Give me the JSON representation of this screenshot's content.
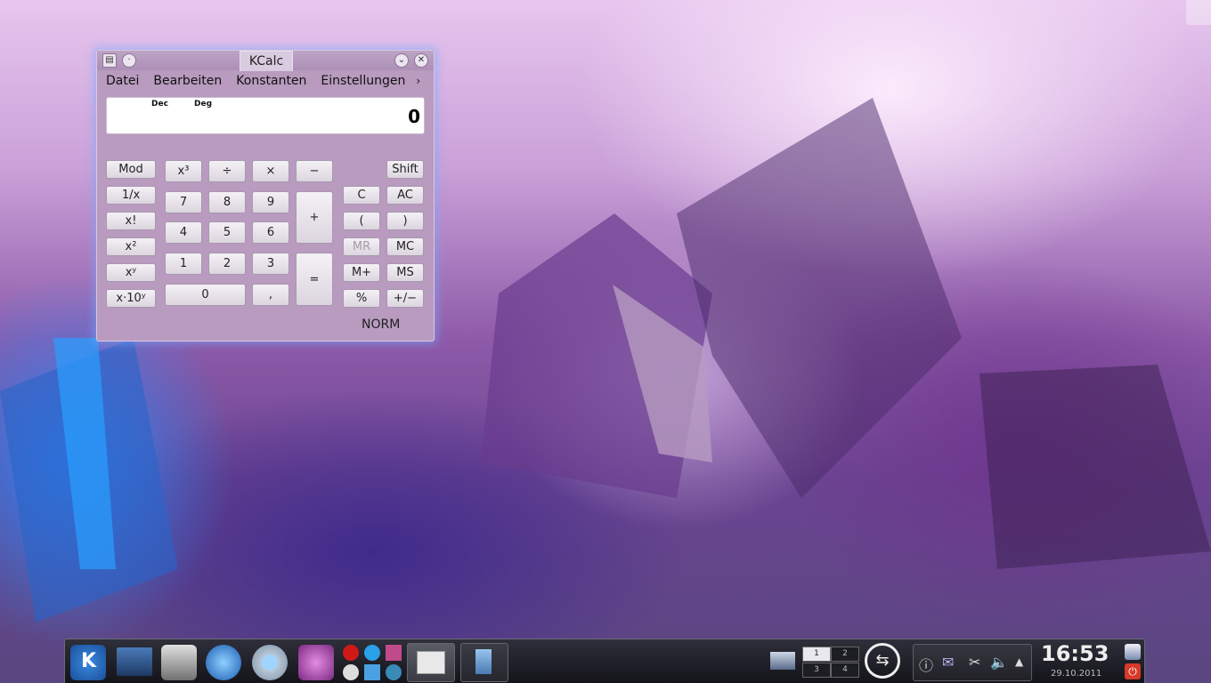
{
  "window": {
    "title": "KCalc",
    "menu": [
      "Datei",
      "Bearbeiten",
      "Konstanten",
      "Einstellungen"
    ],
    "menu_more": "›",
    "display": {
      "base": "Dec",
      "angle": "Deg",
      "value": "0"
    },
    "buttons": {
      "mod": "Mod",
      "inv": "1/x",
      "fact": "x!",
      "sq": "x²",
      "pow": "xʸ",
      "exp": "x·10ʸ",
      "cube": "x³",
      "div": "÷",
      "mul": "×",
      "sub": "−",
      "n7": "7",
      "n8": "8",
      "n9": "9",
      "add": "+",
      "n4": "4",
      "n5": "5",
      "n6": "6",
      "n1": "1",
      "n2": "2",
      "n3": "3",
      "eq": "=",
      "n0": "0",
      "dec": ",",
      "shift": "Shift",
      "c": "C",
      "ac": "AC",
      "lparen": "(",
      "rparen": ")",
      "mr": "MR",
      "mc": "MC",
      "mplus": "M+",
      "ms": "MS",
      "pct": "%",
      "neg": "+/−"
    },
    "status": "NORM"
  },
  "panel": {
    "pager": [
      "1",
      "2",
      "3",
      "4"
    ],
    "clock": "16:53",
    "date": "29.10.2011"
  },
  "colors": {
    "window_bg": "#b89bbf",
    "panel_bg": "#1a1a20",
    "glow": "#78aaff"
  }
}
